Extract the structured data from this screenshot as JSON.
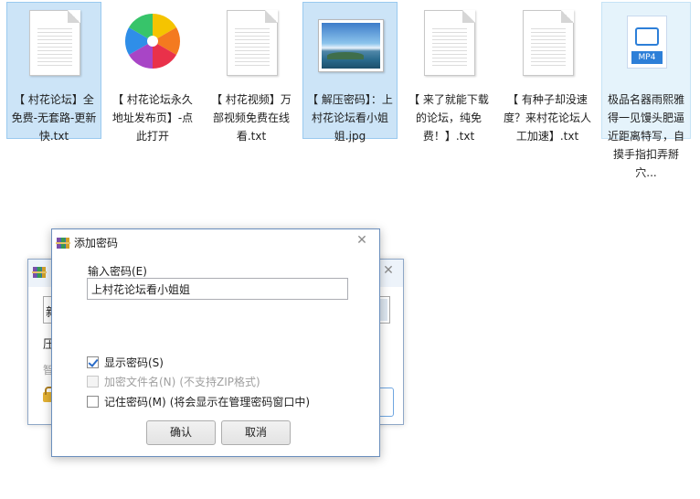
{
  "desktop": {
    "files": [
      {
        "name": "【 村花论坛】全免费-无套路-更新快.txt",
        "type": "txt",
        "state": "selected"
      },
      {
        "name": "【 村花论坛永久地址发布页】-点此打开",
        "type": "shortcut",
        "state": "normal"
      },
      {
        "name": "【 村花视频】万部视频免费在线看.txt",
        "type": "txt",
        "state": "normal"
      },
      {
        "name": "【 解压密码】：上村花论坛看小姐姐.jpg",
        "type": "jpg",
        "state": "selected"
      },
      {
        "name": "【 来了就能下载的论坛，纯免费！】.txt",
        "type": "txt",
        "state": "normal"
      },
      {
        "name": "【 有种子却没速度？来村花论坛人工加速】.txt",
        "type": "txt",
        "state": "normal"
      },
      {
        "name": "极品名器雨熙雅得一见馒头肥逼近距离特写，自摸手指扣弄掰穴...",
        "type": "mp4",
        "state": "hover",
        "badge": "MP4"
      }
    ]
  },
  "background_window": {
    "field_value": "新",
    "label_1": "压",
    "label_2": "智"
  },
  "dialog": {
    "title": "添加密码",
    "close_glyph": "✕",
    "input_label": "输入密码(E)",
    "password_value": "上村花论坛看小姐姐",
    "options": [
      {
        "label": "显示密码(S)",
        "checked": true,
        "enabled": true,
        "note": ""
      },
      {
        "label": "加密文件名(N)",
        "checked": false,
        "enabled": false,
        "note": "(不支持ZIP格式)"
      },
      {
        "label": "记住密码(M)",
        "checked": false,
        "enabled": true,
        "note": "(将会显示在管理密码窗口中)"
      }
    ],
    "ok_label": "确认",
    "cancel_label": "取消"
  },
  "colors": {
    "selection_bg": "#cce4f7",
    "dialog_border": "#6b8fbd",
    "check_mark": "#2a6cc8",
    "mp4_blue": "#2d7fd8"
  }
}
